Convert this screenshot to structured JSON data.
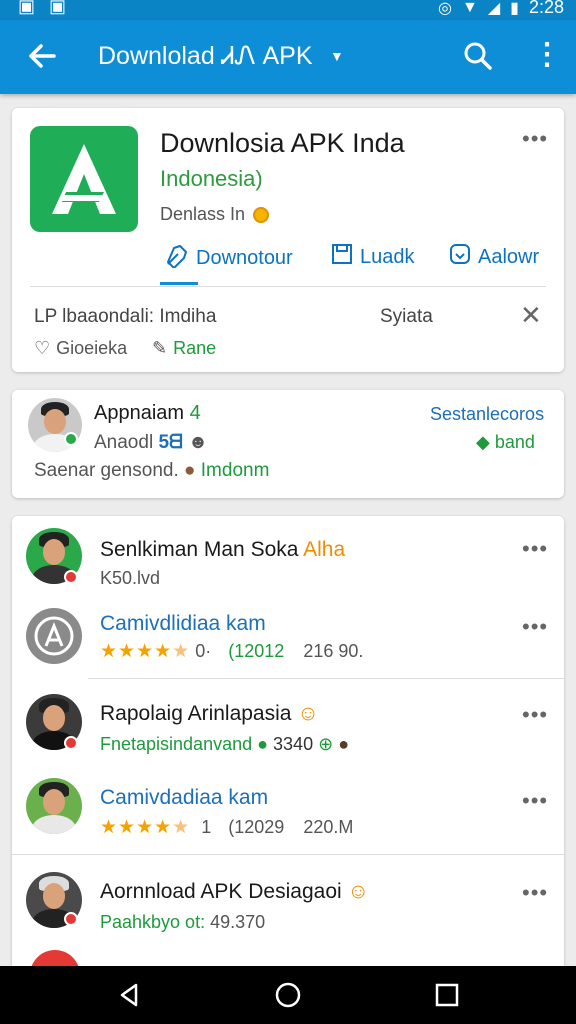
{
  "status_bar": {
    "time": "2:28"
  },
  "app_bar": {
    "title": "Downlolad ᏗᏁ APK",
    "icons": [
      "back-arrow-icon",
      "dropdown-caret-icon",
      "search-icon",
      "more-vert-icon"
    ]
  },
  "app_card": {
    "title": "Downlosia APK Inda",
    "subtitle": "Indonesia)",
    "downloads": "Denlass In",
    "actions": [
      {
        "label": "Downotour",
        "icon": "link-icon"
      },
      {
        "label": "Luadk",
        "icon": "save-icon"
      },
      {
        "label": "Aalowr",
        "icon": "download-badge-icon"
      }
    ],
    "info_left": "LP lbaaondali: Imdiha",
    "info_right": "Syiata",
    "footer_left": "Gioeieka",
    "footer_right": "Rane"
  },
  "profile_card": {
    "name": "Appnaiam",
    "name_suffix": "4",
    "line2": "Anaodl",
    "line2_badge": "5ᗺ",
    "line3": "Saenar gensond.",
    "line3_tag": "Imdonm",
    "right_top": "Sestanlecoros",
    "right_bottom": "band"
  },
  "list": [
    {
      "name": "Senlkiman Man Soka",
      "name_tag": "Alha",
      "sub": "K50.lvd",
      "avatar_bg": "#2aa84a"
    },
    {
      "name": "Camivdlidiaa kam",
      "rating": "★★★★",
      "rating_half": "★",
      "rating_num": "0·",
      "count": "(12012",
      "size": "216 90.",
      "avatar_bg": "#8a8a8a"
    },
    {
      "name": "Rapolaig Arinlapasia",
      "sub": "Fnetapisindanvand",
      "sub_value": "3340",
      "avatar_bg": "#3b3b3b"
    },
    {
      "name": "Camivdadiaa kam",
      "rating": "★★★★",
      "rating_half": "★",
      "rating_num": "1",
      "count": "(12029",
      "size": "220.M",
      "avatar_bg": "#6ab04c"
    },
    {
      "name": "Aornnload APK Desiagaoi",
      "sub": "Paahkbyo ot:",
      "sub_value": "49.370",
      "avatar_bg": "#4a4a4a"
    }
  ],
  "colors": {
    "appbar": "#0d8ed7",
    "accent_green": "#1fae57",
    "link_blue": "#0d73c0",
    "star": "#f4a300"
  }
}
